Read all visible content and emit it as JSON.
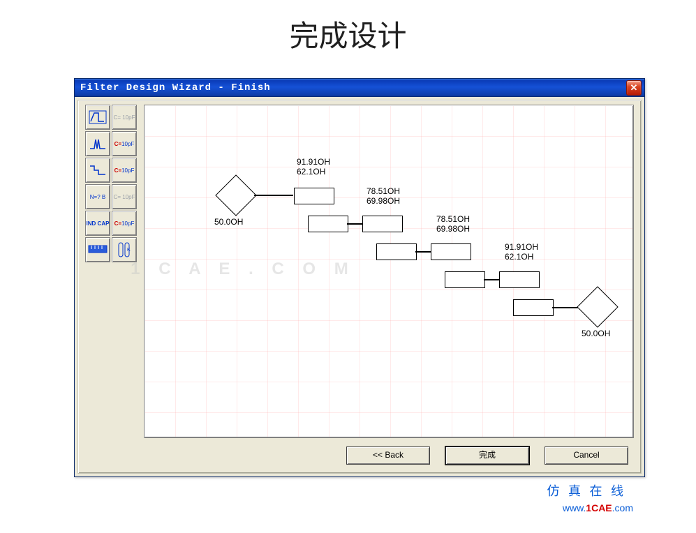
{
  "page": {
    "title_cn": "完成设计"
  },
  "window": {
    "title": "Filter Design Wizard - Finish"
  },
  "toolbox": {
    "t0": "CH",
    "t1": "C=\n10pF",
    "t2": "fn",
    "t3": "C=\n10pF",
    "t4": "step",
    "t5": "C=\n10pF",
    "t6": "N=?\nB",
    "t7": "C=\n10pF",
    "t8": "IND\nCAP",
    "t9": "C=\n10pF",
    "t10": "ruler",
    "t11": "tubes"
  },
  "schematic": {
    "port_in_label": "50.0OH",
    "port_out_label": "50.0OH",
    "stage1_top": "91.91OH",
    "stage1_bot": "62.1OH",
    "stage2_top": "78.51OH",
    "stage2_bot": "69.98OH",
    "stage3_top": "78.51OH",
    "stage3_bot": "69.98OH",
    "stage4_top": "91.91OH",
    "stage4_bot": "62.1OH"
  },
  "watermark": "1 C A E . C O M",
  "buttons": {
    "back": "<< Back",
    "finish": "完成",
    "cancel": "Cancel"
  },
  "branding": {
    "cn": "仿 真 在 线",
    "url_plain": "www.",
    "url_accent": "1CAE",
    "url_tail": ".com"
  }
}
